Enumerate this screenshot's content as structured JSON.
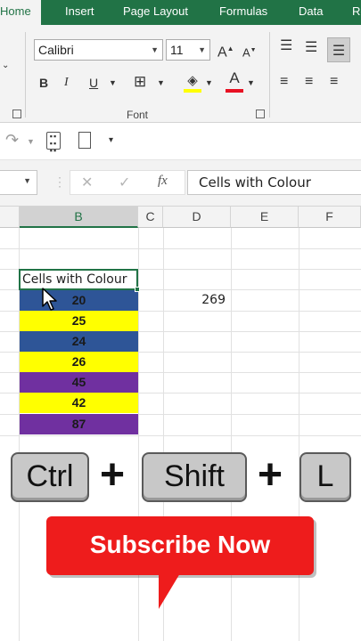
{
  "ribbon": {
    "tabs": [
      "Home",
      "Insert",
      "Page Layout",
      "Formulas",
      "Data",
      "Re"
    ],
    "font_name": "Calibri",
    "font_size": "11",
    "group_label": "Font",
    "bold": "B",
    "italic": "I",
    "underline": "U",
    "grow": "A",
    "shrink": "A"
  },
  "formula_bar": {
    "fx": "fx",
    "cancel": "✕",
    "enter": "✓",
    "content": "Cells with Colour"
  },
  "columns": [
    "B",
    "C",
    "D",
    "E",
    "F"
  ],
  "sheet": {
    "header_cell": "Cells with Colour",
    "cells": [
      {
        "value": "20",
        "color": "#2e5597"
      },
      {
        "value": "25",
        "color": "#ffff00"
      },
      {
        "value": "24",
        "color": "#2e5597"
      },
      {
        "value": "26",
        "color": "#ffff00"
      },
      {
        "value": "45",
        "color": "#7030a0"
      },
      {
        "value": "42",
        "color": "#ffff00"
      },
      {
        "value": "87",
        "color": "#7030a0"
      }
    ],
    "d_value": "269"
  },
  "shortcut": {
    "key1": "Ctrl",
    "key2": "Shift",
    "key3": "L",
    "plus": "+"
  },
  "subscribe": "Subscribe Now",
  "colors": {
    "excel_green": "#217346",
    "subscribe_red": "#ee1c1c"
  }
}
